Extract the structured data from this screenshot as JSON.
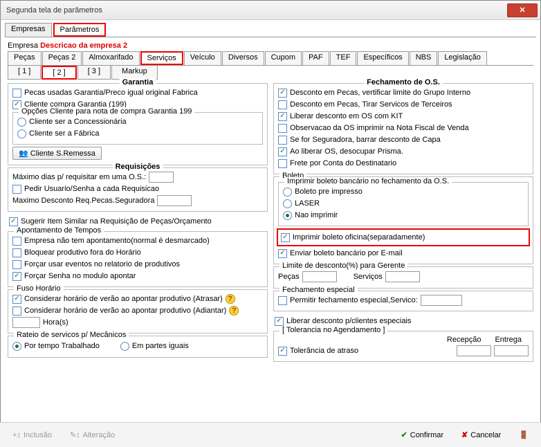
{
  "title": "Segunda tela de parâmetros",
  "topTabs": {
    "empresas": "Empresas",
    "parametros": "Parâmetros"
  },
  "empresa": {
    "label": "Empresa",
    "value": "Descricao da empresa 2"
  },
  "subTabs": [
    "Peças",
    "Peças 2",
    "Almoxarifado",
    "Serviços",
    "Veículo",
    "Diversos",
    "Cupom",
    "PAF",
    "TEF",
    "Específicos",
    "NBS",
    "Legislação"
  ],
  "subSubTabs": [
    "[ 1 ]",
    "[ 2 ]",
    "[ 3 ]",
    "Markup"
  ],
  "garantia": {
    "legend": "Garantia",
    "pecasUsadas": "Pecas usadas Garantia/Preco igual original Fabrica",
    "clienteCompra": "Cliente compra Garantia (199)",
    "opcoesCliente": {
      "legend": "Opções Cliente para nota de compra Garantia 199",
      "concessionaria": "Cliente ser a Concessionária",
      "fabrica": "Cliente ser a Fábrica"
    },
    "btnSRemessa": "Cliente S.Remessa"
  },
  "requisicoes": {
    "legend": "Requisições",
    "maxDias": "Máximo dias p/ requisitar em uma O.S.:",
    "pedirUsuario": "Pedir Usuario/Senha a cada Requisicao",
    "maxDesc": "Maximo Desconto Req.Pecas.Seguradora",
    "sugerir": "Sugerir Item Similar na Requisição de Peças/Orçamento"
  },
  "apontamento": {
    "legend": "Apontamento de Tempos",
    "naoTem": "Empresa não tem apontamento(normal é desmarcado)",
    "bloquear": "Bloquear produtivo fora do Horário",
    "forcarEventos": "Forçar usar eventos no relatorio de produtivos",
    "forcarSenha": "Forçar Senha no modulo apontar"
  },
  "fuso": {
    "legend": "Fuso Horário",
    "atrasar": "Considerar horário de verão ao apontar produtivo (Atrasar)",
    "adiantar": "Considerar horário de verão ao apontar produtivo (Adiantar)",
    "horas": "Hora(s)"
  },
  "rateio": {
    "legend": "Rateio de servicos p/ Mecânicos",
    "tempo": "Por tempo Trabalhado",
    "partes": "Em partes iguais"
  },
  "fechamento": {
    "legend": "Fechamento de O.S.",
    "descPecasGrupo": "Desconto em Pecas, vertificar limite do Grupo Interno",
    "descPecasTerc": "Desconto em Pecas, Tirar Servicos de Terceiros",
    "liberarKit": "Liberar desconto em OS com KIT",
    "obsOS": "Observacao da OS imprimir na Nota Fiscal de Venda",
    "seguradora": "Se for Seguradora, barrar desconto de Capa",
    "liberarPrisma": "Ao liberar OS, desocupar Prisma.",
    "freteDest": "Frete por Conta do Destinatario"
  },
  "boleto": {
    "legend": "Boleto",
    "imprimirLegend": "Imprimir boleto bancário no fechamento da O.S.",
    "preImp": "Boleto pre impresso",
    "laser": "LASER",
    "naoImprimir": "Nao imprimir",
    "imprimirOficina": "Imprimir boleto oficina(separadamente)",
    "enviarEmail": "Enviar boleto bancário por E-mail"
  },
  "limite": {
    "legend": "Limite de desconto(%) para Gerente",
    "pecas": "Peças",
    "servicos": "Serviços"
  },
  "fechEsp": {
    "legend": "Fechamento especial",
    "permitir": "Permitir fechamento especial,Servico:"
  },
  "liberarCli": "Liberar desconto p/clientes especiais",
  "tolerancia": {
    "legend": "[ Tolerancia no Agendamento ]",
    "atraso": "Tolerância de atraso",
    "recepcao": "Recepção",
    "entrega": "Entrega"
  },
  "footer": {
    "inclusao": "Inclusão",
    "alteracao": "Alteração",
    "confirmar": "Confirmar",
    "cancelar": "Cancelar"
  }
}
